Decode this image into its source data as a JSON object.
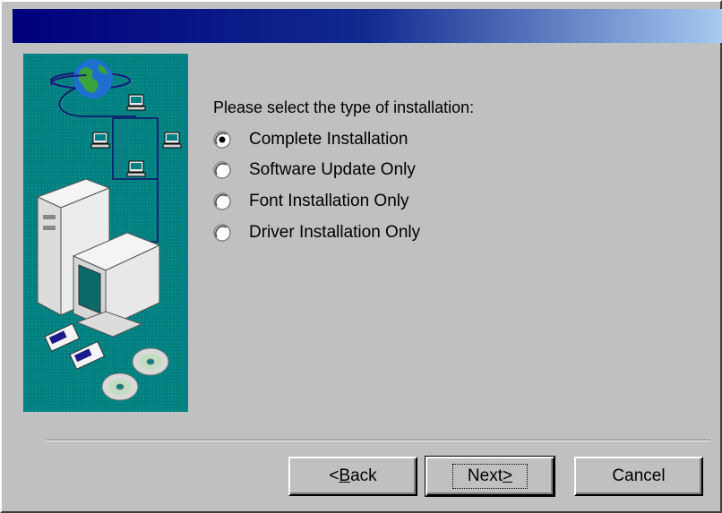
{
  "window": {
    "title": ""
  },
  "install": {
    "prompt": "Please select the type of installation:",
    "options": [
      {
        "label": "Complete Installation",
        "selected": true
      },
      {
        "label": "Software Update Only",
        "selected": false
      },
      {
        "label": "Font Installation Only",
        "selected": false
      },
      {
        "label": "Driver Installation Only",
        "selected": false
      }
    ]
  },
  "buttons": {
    "back": {
      "mnemonic": "B",
      "rest": "ack",
      "prefix": "<"
    },
    "next": {
      "text": "Next",
      "suffix": ">"
    },
    "cancel": {
      "label": "Cancel"
    }
  },
  "colors": {
    "titlebar_start": "#00007b",
    "titlebar_end": "#a6caf0",
    "art_background": "#008080",
    "face": "#c0c0c0"
  },
  "icons": [
    "globe-icon",
    "network-computer-icon",
    "desktop-computer-icon",
    "floppy-disk-icon",
    "cd-rom-icon"
  ]
}
